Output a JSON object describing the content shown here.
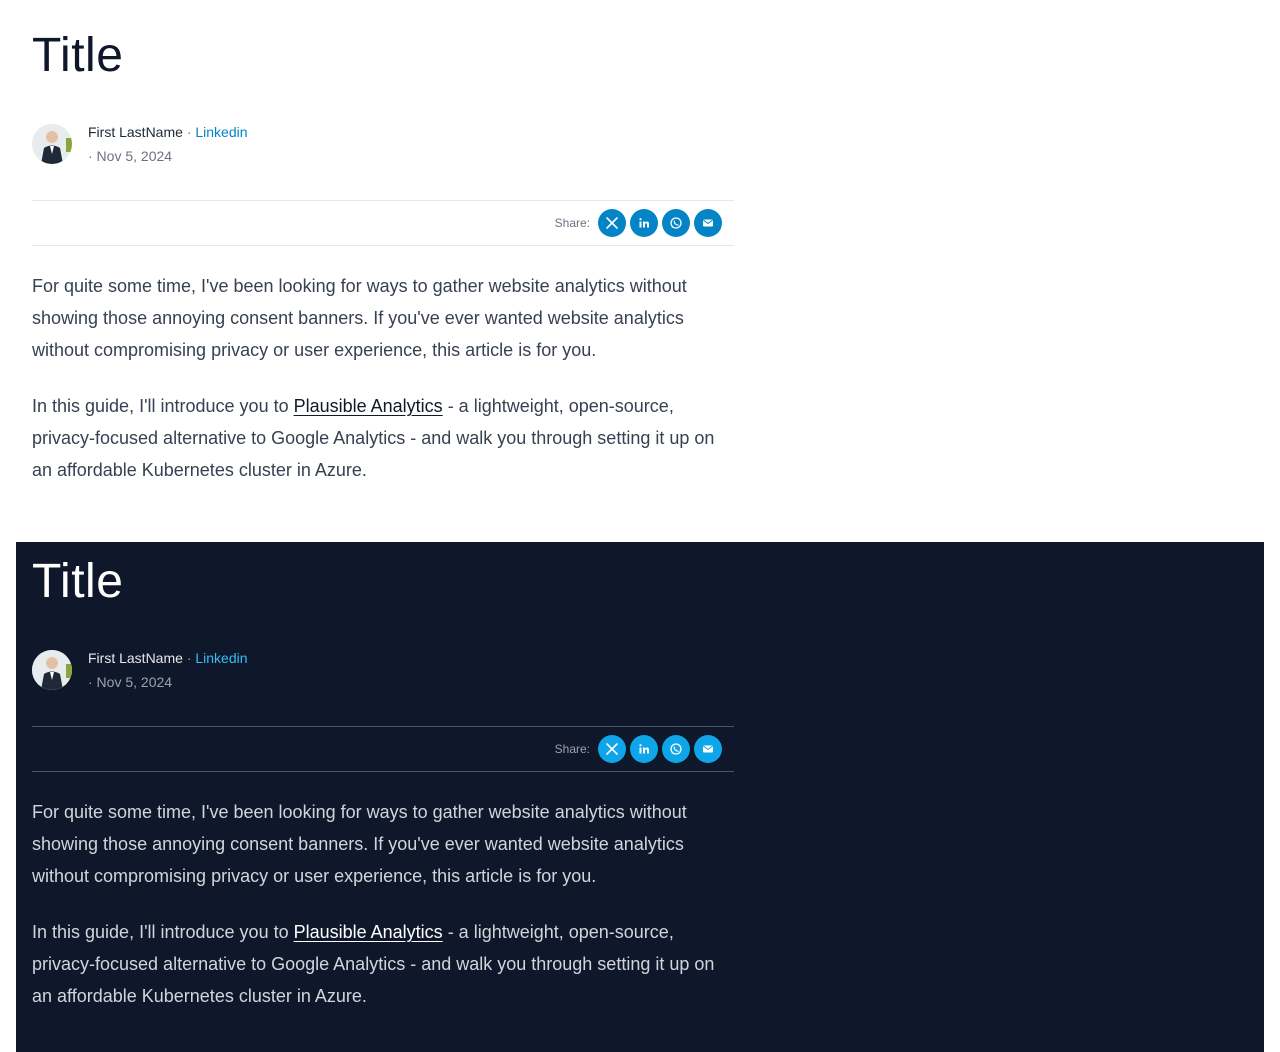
{
  "article_light": {
    "title": "Title",
    "author": {
      "name": "First LastName",
      "separator": "·",
      "social_link": "Linkedin",
      "date": "· Nov 5, 2024",
      "avatar_icon": "person-photo-icon"
    },
    "share": {
      "label": "Share:",
      "buttons": [
        {
          "label": "X",
          "icon": "x-logo-icon"
        },
        {
          "label": "LinkedIn",
          "icon": "linkedin-icon"
        },
        {
          "label": "WhatsApp",
          "icon": "whatsapp-icon"
        },
        {
          "label": "Email",
          "icon": "mail-icon"
        }
      ]
    },
    "paragraph1": "For quite some time, I've been looking for ways to gather website analytics without showing those annoying consent banners. If you've ever wanted website analytics without compromising privacy or user experience, this article is for you.",
    "paragraph2_before": "In this guide, I'll introduce you to ",
    "paragraph2_link": "Plausible Analytics",
    "paragraph2_after": " - a lightweight, open-source, privacy-focused alternative to Google Analytics - and walk you through setting it up on an affordable Kubernetes cluster in Azure."
  },
  "article_dark": {
    "title": "Title",
    "author": {
      "name": "First LastName",
      "separator": "·",
      "social_link": "Linkedin",
      "date": "· Nov 5, 2024",
      "avatar_icon": "person-photo-icon"
    },
    "share": {
      "label": "Share:",
      "buttons": [
        {
          "label": "X",
          "icon": "x-logo-icon"
        },
        {
          "label": "LinkedIn",
          "icon": "linkedin-icon"
        },
        {
          "label": "WhatsApp",
          "icon": "whatsapp-icon"
        },
        {
          "label": "Email",
          "icon": "mail-icon"
        }
      ]
    },
    "paragraph1": "For quite some time, I've been looking for ways to gather website analytics without showing those annoying consent banners. If you've ever wanted website analytics without compromising privacy or user experience, this article is for you.",
    "paragraph2_before": "In this guide, I'll introduce you to ",
    "paragraph2_link": "Plausible Analytics",
    "paragraph2_after": " - a lightweight, open-source, privacy-focused alternative to Google Analytics - and walk you through setting it up on an affordable Kubernetes cluster in Azure."
  },
  "colors": {
    "light_background": "#ffffff",
    "dark_background": "#0f172a",
    "accent": "#0284c7",
    "dark_accent": "#0ea5e9"
  }
}
